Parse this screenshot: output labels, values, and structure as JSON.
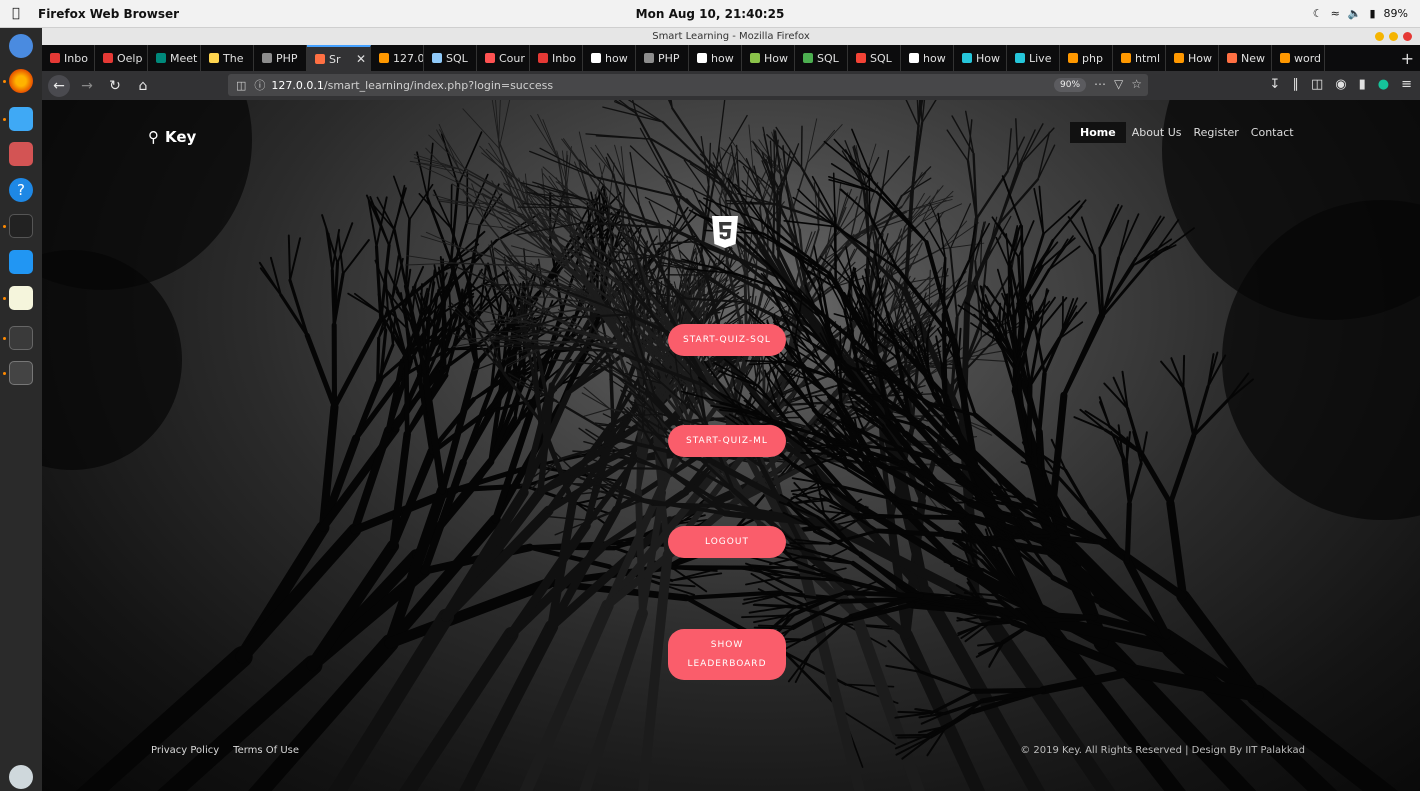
{
  "os": {
    "app_name": "Firefox Web Browser",
    "clock": "Mon Aug 10, 21:40:25",
    "battery": "89%"
  },
  "browser": {
    "window_title": "Smart Learning - Mozilla Firefox",
    "tabs": [
      {
        "label": "Inbo",
        "color": "#e53935"
      },
      {
        "label": "Oelp",
        "color": "#e53935"
      },
      {
        "label": "Meet",
        "color": "#00897b"
      },
      {
        "label": "The",
        "color": "#ffd54f"
      },
      {
        "label": "PHP",
        "color": "#8d8d8d"
      },
      {
        "label": "Sr",
        "color": "#ff7043",
        "active": true
      },
      {
        "label": "127.0",
        "color": "#ff9800"
      },
      {
        "label": "SQL",
        "color": "#90caf9"
      },
      {
        "label": "Cour",
        "color": "#ff5252"
      },
      {
        "label": "Inbo",
        "color": "#e53935"
      },
      {
        "label": "how",
        "color": "#ffffff"
      },
      {
        "label": "PHP",
        "color": "#8d8d8d"
      },
      {
        "label": "how",
        "color": "#ffffff"
      },
      {
        "label": "How",
        "color": "#8bc34a"
      },
      {
        "label": "SQL",
        "color": "#4caf50"
      },
      {
        "label": "SQL",
        "color": "#f44336"
      },
      {
        "label": "how",
        "color": "#ffffff"
      },
      {
        "label": "How",
        "color": "#26c6da"
      },
      {
        "label": "Live",
        "color": "#26c6da"
      },
      {
        "label": "php",
        "color": "#ff9800"
      },
      {
        "label": "html",
        "color": "#ff9800"
      },
      {
        "label": "How",
        "color": "#ff9800"
      },
      {
        "label": "New",
        "color": "#ff7043"
      },
      {
        "label": "word",
        "color": "#ff9800"
      }
    ],
    "new_tab": "+",
    "url_host": "127.0.0.1",
    "url_path": "/smart_learning/index.php?login=success",
    "zoom": "90%"
  },
  "site": {
    "brand": "Key",
    "nav": [
      {
        "label": "Home",
        "active": true
      },
      {
        "label": "About Us"
      },
      {
        "label": "Register"
      },
      {
        "label": "Contact"
      }
    ],
    "buttons": {
      "quiz_sql": "START-QUIZ-SQL",
      "quiz_ml": "START-QUIZ-ML",
      "logout": "LOGOUT",
      "leaderboard": "SHOW LEADERBOARD"
    },
    "footer": {
      "privacy": "Privacy Policy",
      "terms": "Terms Of Use",
      "copyright": "© 2019 Key. All Rights Reserved | Design By IIT Palakkad"
    },
    "accent": "#fa5d6b"
  }
}
